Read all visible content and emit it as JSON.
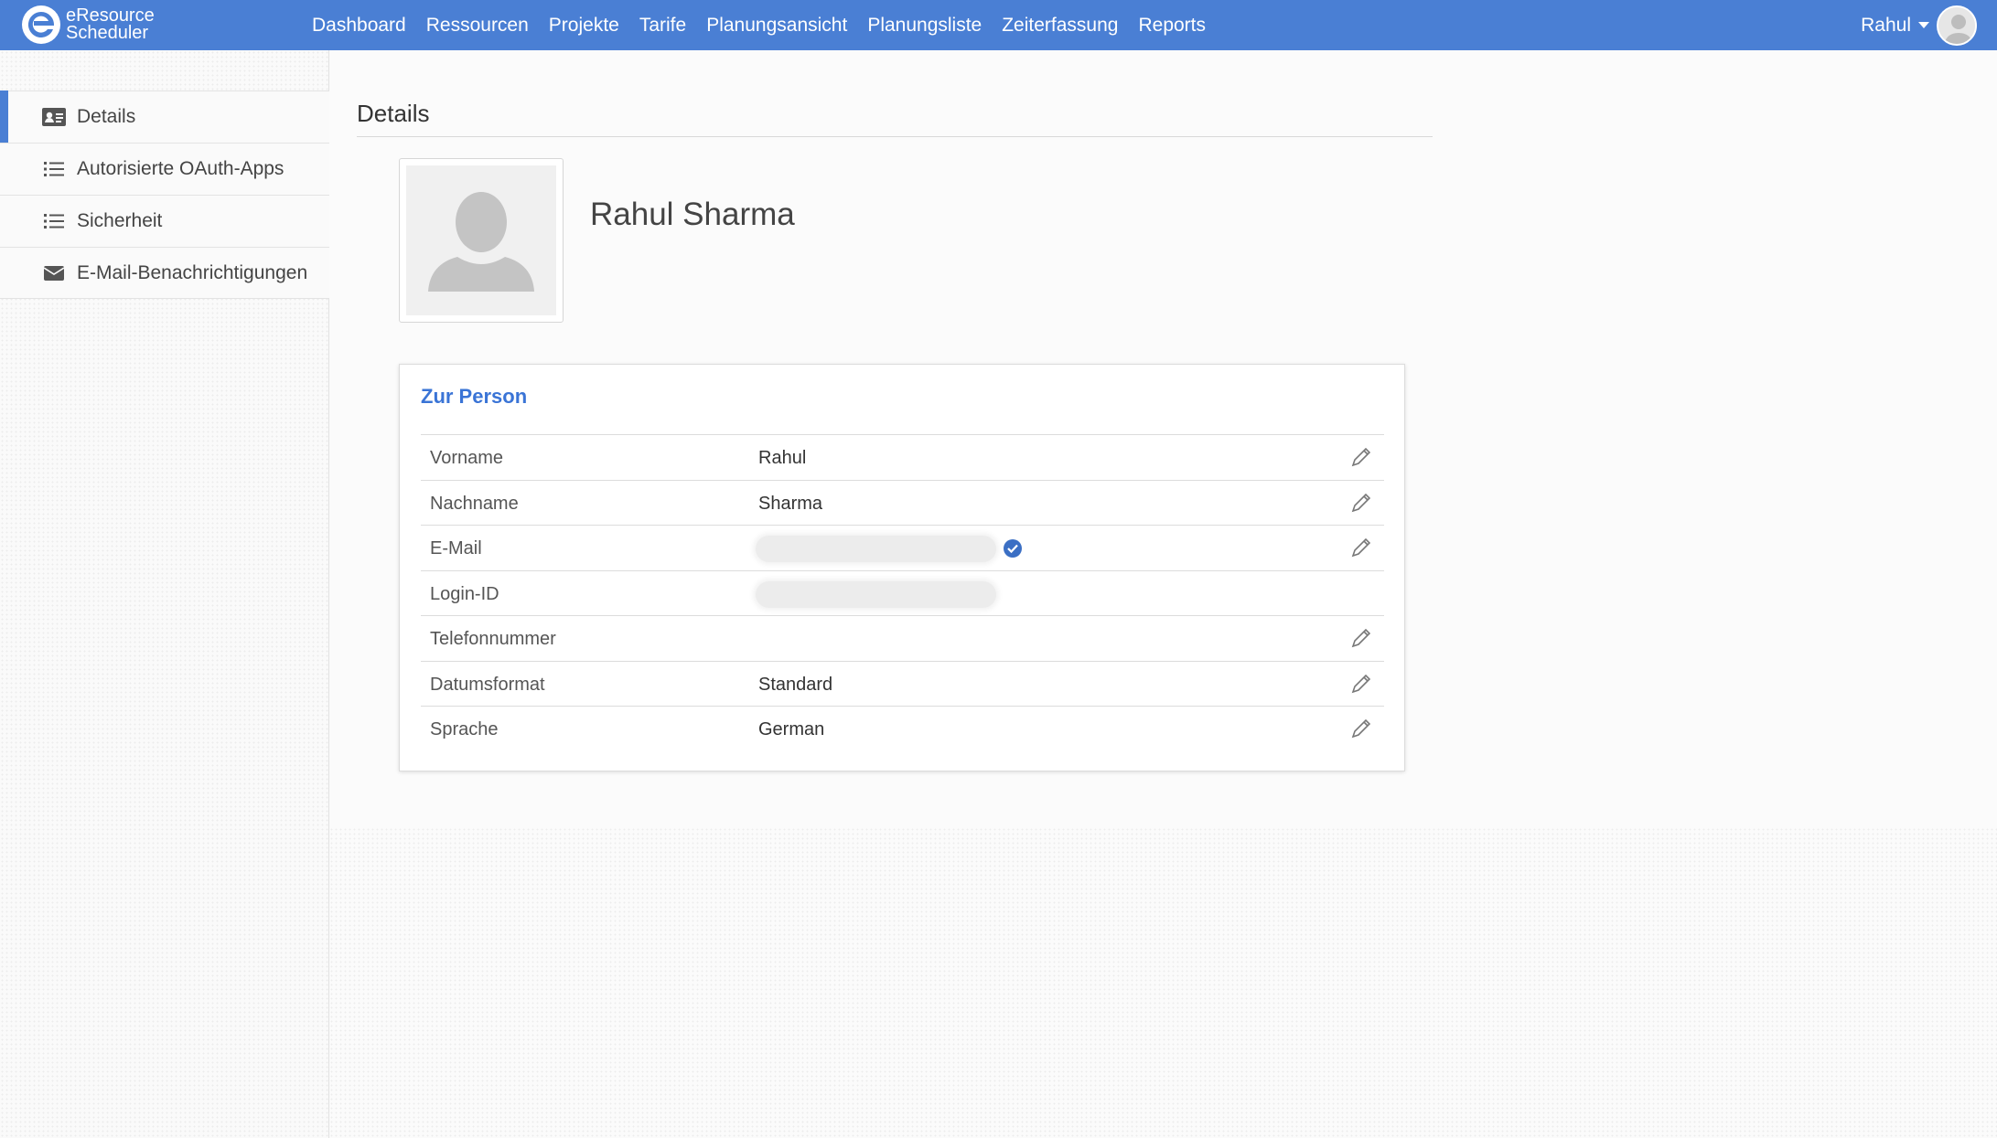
{
  "brand": {
    "line1": "eResource",
    "line2": "Scheduler"
  },
  "nav": [
    "Dashboard",
    "Ressourcen",
    "Projekte",
    "Tarife",
    "Planungsansicht",
    "Planungsliste",
    "Zeiterfassung",
    "Reports"
  ],
  "user": {
    "name": "Rahul"
  },
  "sidebar": {
    "items": [
      {
        "label": "Details",
        "icon": "id-card-icon",
        "active": true
      },
      {
        "label": "Autorisierte OAuth-Apps",
        "icon": "list-icon",
        "active": false
      },
      {
        "label": "Sicherheit",
        "icon": "list-icon",
        "active": false
      },
      {
        "label": "E-Mail-Benachrichtigungen",
        "icon": "envelope-icon",
        "active": false
      }
    ]
  },
  "page": {
    "title": "Details",
    "profile_name": "Rahul Sharma"
  },
  "card": {
    "title": "Zur Person",
    "rows": [
      {
        "label": "Vorname",
        "value": "Rahul",
        "editable": true
      },
      {
        "label": "Nachname",
        "value": "Sharma",
        "editable": true
      },
      {
        "label": "E-Mail",
        "value": "",
        "masked": true,
        "verified": true,
        "editable": true
      },
      {
        "label": "Login-ID",
        "value": "",
        "masked": true,
        "editable": false
      },
      {
        "label": "Telefonnummer",
        "value": "",
        "editable": true
      },
      {
        "label": "Datumsformat",
        "value": "Standard",
        "editable": true
      },
      {
        "label": "Sprache",
        "value": "German",
        "editable": true
      }
    ]
  },
  "colors": {
    "brand": "#4a7fd4",
    "accent": "#3a74d6",
    "verified": "#3b6fc4"
  }
}
